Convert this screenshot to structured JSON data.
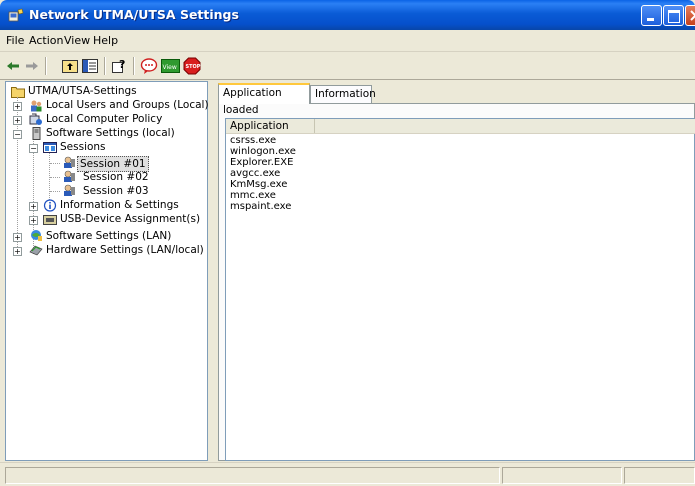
{
  "window": {
    "title": "Network UTMA/UTSA Settings"
  },
  "menu": [
    {
      "label": "File"
    },
    {
      "label": "Action"
    },
    {
      "label": "View"
    },
    {
      "label": "Help"
    }
  ],
  "toolbar": {
    "buttons": [
      {
        "icon": "back-arrow-icon"
      },
      {
        "icon": "forward-arrow-icon"
      },
      {
        "icon": "up-folder-icon"
      },
      {
        "icon": "show-hide-tree-icon"
      },
      {
        "icon": "help-icon"
      },
      {
        "icon": "message-icon"
      },
      {
        "icon": "view-icon",
        "text": "View"
      },
      {
        "icon": "stop-icon",
        "text": "STOP"
      }
    ]
  },
  "tree": {
    "root": "UTMA/UTSA-Settings",
    "items": [
      {
        "label": "Local Users and Groups (Local)"
      },
      {
        "label": "Local Computer Policy"
      },
      {
        "label": "Software Settings (local)"
      },
      {
        "label": "Sessions"
      },
      {
        "label": "Session #01"
      },
      {
        "label": "Session #02"
      },
      {
        "label": "Session #03"
      },
      {
        "label": "Information & Settings"
      },
      {
        "label": "USB-Device Assignment(s)"
      },
      {
        "label": "Software Settings (LAN)"
      },
      {
        "label": "Hardware Settings (LAN/local)"
      }
    ]
  },
  "tabs": [
    {
      "label": "Application loaded",
      "active": true
    },
    {
      "label": "Information",
      "active": false
    }
  ],
  "list": {
    "columns": [
      "Application"
    ],
    "rows": [
      "csrss.exe",
      "winlogon.exe",
      "Explorer.EXE",
      "avgcc.exe",
      "KmMsg.exe",
      "mmc.exe",
      "mspaint.exe"
    ]
  }
}
